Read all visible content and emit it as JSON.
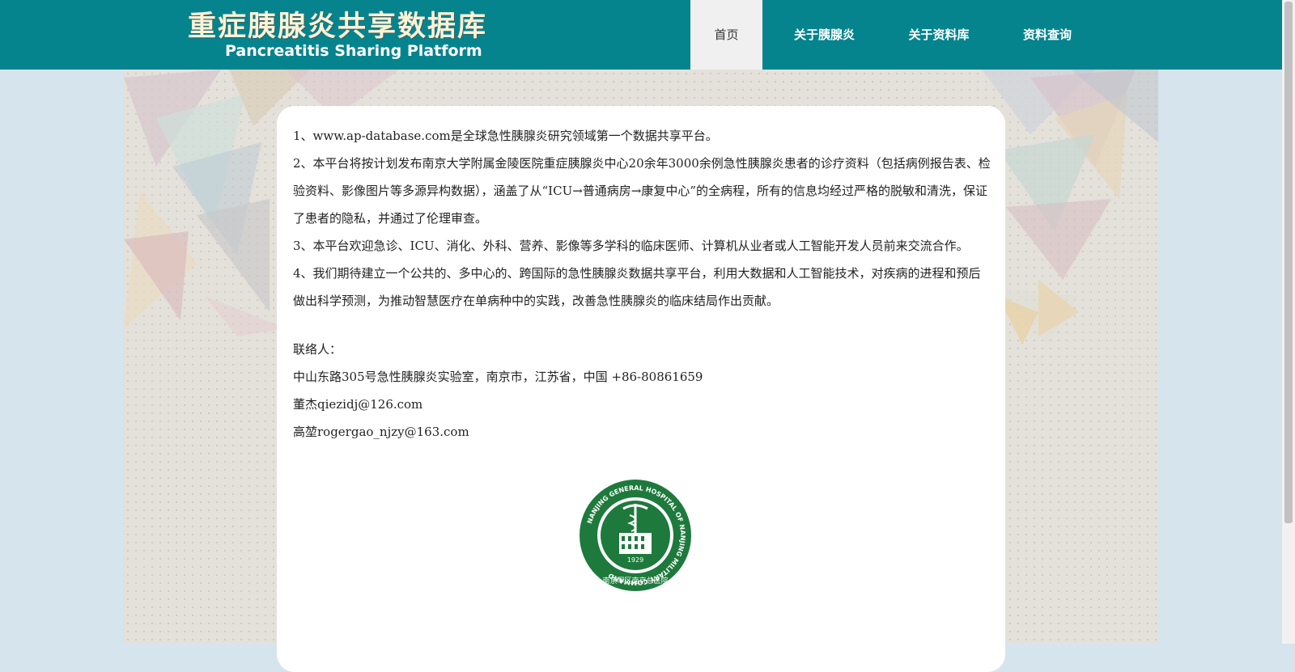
{
  "header": {
    "title_cn": "重症胰腺炎共享数据库",
    "title_en": "Pancreatitis Sharing Platform",
    "bg_color": "#05848e"
  },
  "nav": {
    "items": [
      {
        "label": "首页",
        "active": true
      },
      {
        "label": "关于胰腺炎",
        "active": false
      },
      {
        "label": "关于资料库",
        "active": false
      },
      {
        "label": "资料查询",
        "active": false
      }
    ]
  },
  "intro": {
    "paragraphs": [
      "1、www.ap-database.com是全球急性胰腺炎研究领域第一个数据共享平台。",
      "2、本平台将按计划发布南京大学附属金陵医院重症胰腺炎中心20余年3000余例急性胰腺炎患者的诊疗资料（包括病例报告表、检验资料、影像图片等多源异构数据），涵盖了从“ICU→普通病房→康复中心”的全病程，所有的信息均经过严格的脱敏和清洗，保证了患者的隐私，并通过了伦理审查。",
      "3、本平台欢迎急诊、ICU、消化、外科、营养、影像等多学科的临床医师、计算机从业者或人工智能开发人员前来交流合作。",
      "4、我们期待建立一个公共的、多中心的、跨国际的急性胰腺炎数据共享平台，利用大数据和人工智能技术，对疾病的进程和预后做出科学预测，为推动智慧医疗在单病种中的实践，改善急性胰腺炎的临床结局作出贡献。"
    ]
  },
  "contact": {
    "label": "联络人：",
    "address": "中山东路305号急性胰腺炎实验室，南京市，江苏省，中国 +86-80861659",
    "person1": "董杰qiezidj@126.com",
    "person2": "高堃rogergao_njzy@163.com"
  },
  "seal": {
    "outer_text": "NANJING GENERAL HOSPITAL OF NANJING MILITARY COMMAND",
    "year": "1929",
    "bottom_text": "南京军区南京总医院",
    "color": "#1e7a3c"
  }
}
